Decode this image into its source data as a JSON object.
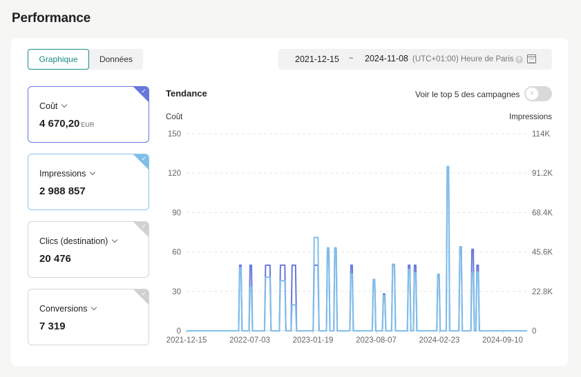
{
  "page": {
    "title": "Performance"
  },
  "view_toggle": {
    "chart_label": "Graphique",
    "data_label": "Données",
    "active": "Graphique"
  },
  "date_range": {
    "start": "2021-12-15",
    "separator": "~",
    "end": "2024-11-08",
    "timezone": "(UTC+01:00) Heure de Paris",
    "help_icon": "question-circle-icon",
    "calendar_icon": "calendar-icon"
  },
  "metrics": [
    {
      "label": "Coût",
      "value": "4 670,20",
      "unit": "EUR",
      "selected": true,
      "color": "#6777dc"
    },
    {
      "label": "Impressions",
      "value": "2 988 857",
      "unit": "",
      "selected": true,
      "color": "#7fbfe9"
    },
    {
      "label": "Clics (destination)",
      "value": "20 476",
      "unit": "",
      "selected": false,
      "color": "#d0d0d0"
    },
    {
      "label": "Conversions",
      "value": "7 319",
      "unit": "",
      "selected": false,
      "color": "#d0d0d0"
    }
  ],
  "trend": {
    "title": "Tendance",
    "top5_label": "Voir le top 5 des campagnes",
    "top5_enabled": false
  },
  "chart_data": {
    "type": "line",
    "title": "Tendance",
    "ylabel": "Coût",
    "y2label": "Impressions",
    "ylim": [
      0,
      150
    ],
    "y2lim": [
      0,
      114000
    ],
    "y_ticks": [
      "0",
      "30",
      "60",
      "90",
      "120",
      "150"
    ],
    "y2_ticks": [
      "0",
      "22.8K",
      "45.6K",
      "68.4K",
      "91.2K",
      "114K"
    ],
    "x_ticks": [
      "2021-12-15",
      "2022-07-03",
      "2023-01-19",
      "2023-08-07",
      "2024-02-23",
      "2024-09-10"
    ],
    "xlim": [
      "2021-12-15",
      "2024-11-08"
    ],
    "grid": true,
    "legend": "none",
    "series": [
      {
        "name": "Coût",
        "axis": "left",
        "color": "#6777dc",
        "spikes": [
          {
            "date": "2022-06-01",
            "days": 4,
            "value": 50
          },
          {
            "date": "2022-07-04",
            "days": 4,
            "value": 50
          },
          {
            "date": "2022-08-22",
            "days": 14,
            "value": 50
          },
          {
            "date": "2022-10-08",
            "days": 14,
            "value": 50
          },
          {
            "date": "2022-11-14",
            "days": 11,
            "value": 50
          },
          {
            "date": "2023-01-23",
            "days": 12,
            "value": 50
          },
          {
            "date": "2023-03-06",
            "days": 3,
            "value": 63
          },
          {
            "date": "2023-03-29",
            "days": 3,
            "value": 63
          },
          {
            "date": "2023-05-19",
            "days": 3,
            "value": 50
          },
          {
            "date": "2023-07-29",
            "days": 2,
            "value": 39
          },
          {
            "date": "2023-08-30",
            "days": 2,
            "value": 28
          },
          {
            "date": "2023-09-28",
            "days": 6,
            "value": 50
          },
          {
            "date": "2023-11-17",
            "days": 3,
            "value": 50
          },
          {
            "date": "2023-12-06",
            "days": 3,
            "value": 50
          },
          {
            "date": "2024-02-18",
            "days": 2,
            "value": 43
          },
          {
            "date": "2024-03-19",
            "days": 4,
            "value": 125
          },
          {
            "date": "2024-04-28",
            "days": 3,
            "value": 64
          },
          {
            "date": "2024-06-05",
            "days": 3,
            "value": 62
          },
          {
            "date": "2024-06-21",
            "days": 3,
            "value": 50
          }
        ]
      },
      {
        "name": "Impressions",
        "axis": "right",
        "color": "#7fbfe9",
        "spikes": [
          {
            "date": "2022-06-01",
            "days": 4,
            "value": 36500
          },
          {
            "date": "2022-07-04",
            "days": 4,
            "value": 25500
          },
          {
            "date": "2022-08-22",
            "days": 14,
            "value": 31000
          },
          {
            "date": "2022-10-08",
            "days": 14,
            "value": 29000
          },
          {
            "date": "2022-11-14",
            "days": 11,
            "value": 15000
          },
          {
            "date": "2023-01-23",
            "days": 12,
            "value": 54000
          },
          {
            "date": "2023-03-06",
            "days": 3,
            "value": 48000
          },
          {
            "date": "2023-03-29",
            "days": 3,
            "value": 48000
          },
          {
            "date": "2023-05-19",
            "days": 3,
            "value": 33000
          },
          {
            "date": "2023-07-29",
            "days": 2,
            "value": 29500
          },
          {
            "date": "2023-08-30",
            "days": 2,
            "value": 20500
          },
          {
            "date": "2023-09-28",
            "days": 6,
            "value": 38500
          },
          {
            "date": "2023-11-17",
            "days": 3,
            "value": 35500
          },
          {
            "date": "2023-12-06",
            "days": 3,
            "value": 33500
          },
          {
            "date": "2024-02-18",
            "days": 2,
            "value": 32500
          },
          {
            "date": "2024-03-19",
            "days": 4,
            "value": 95000
          },
          {
            "date": "2024-04-28",
            "days": 3,
            "value": 48500
          },
          {
            "date": "2024-06-05",
            "days": 3,
            "value": 33500
          },
          {
            "date": "2024-06-21",
            "days": 3,
            "value": 34000
          }
        ]
      }
    ]
  }
}
